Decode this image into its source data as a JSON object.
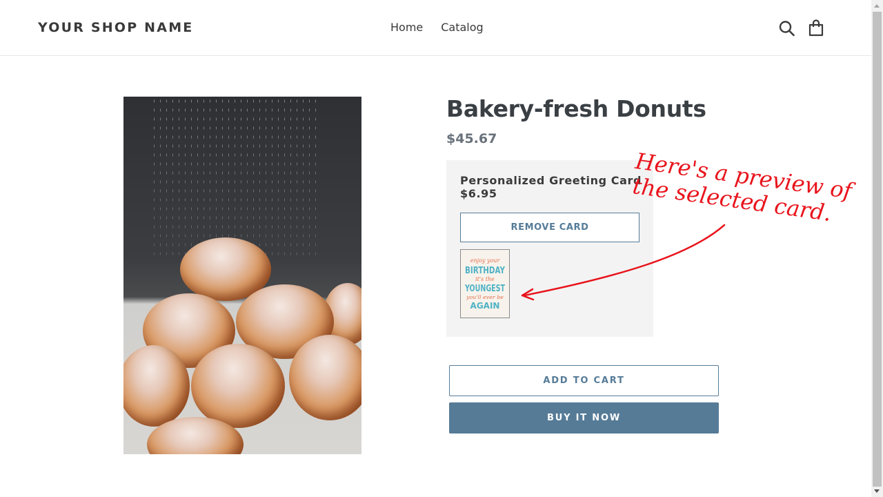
{
  "header": {
    "shop_name": "YOUR SHOP NAME",
    "nav": [
      {
        "label": "Home"
      },
      {
        "label": "Catalog"
      }
    ],
    "icons": {
      "search": "search-icon",
      "cart": "shopping-bag-icon"
    }
  },
  "product": {
    "title": "Bakery-fresh Donuts",
    "price": "$45.67",
    "image_alt": "Powdered sugar being sprinkled on a pile of donuts"
  },
  "greeting_card": {
    "name": "Personalized Greeting Card",
    "price": "$6.95",
    "remove_label": "REMOVE CARD",
    "preview_lines": [
      "enjoy your",
      "BIRTHDAY",
      "it's the",
      "YOUNGEST",
      "you'll ever be",
      "AGAIN"
    ]
  },
  "actions": {
    "add_to_cart": "ADD TO CART",
    "buy_now": "BUY IT NOW"
  },
  "annotation": {
    "line1": "Here's a preview of",
    "line2": "the selected card.",
    "color": "#e8141c"
  },
  "colors": {
    "accent": "#557b97",
    "card_box_bg": "#f3f3f3",
    "text": "#3a3a3a"
  }
}
